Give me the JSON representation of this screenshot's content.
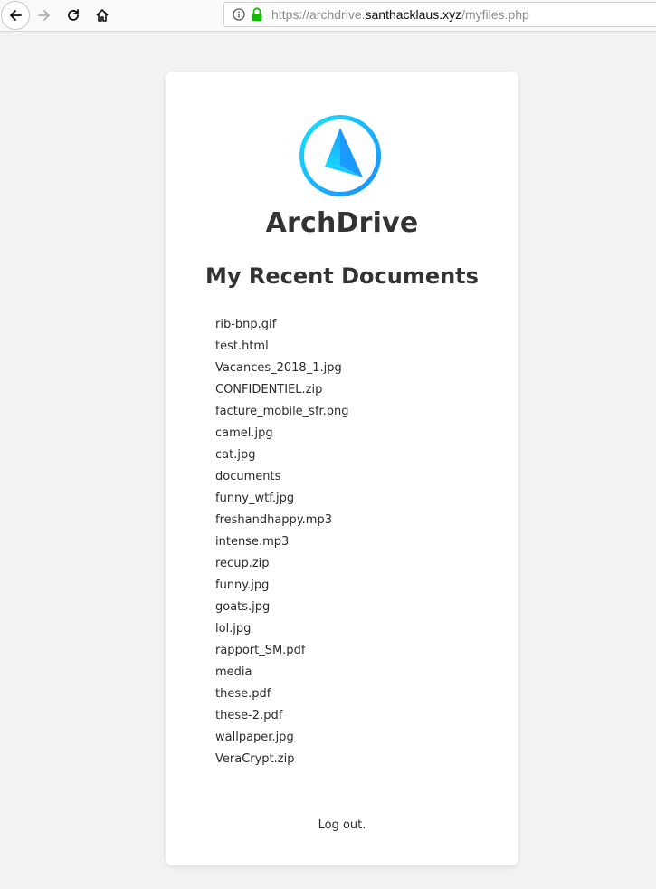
{
  "browser": {
    "url_scheme": "https://archdrive.",
    "url_domain": "santhacklaus.xyz",
    "url_path": "/myfiles.php"
  },
  "colors": {
    "logo_gradient_start": "#19e0ff",
    "logo_gradient_end": "#1a8cff",
    "lock_green": "#12bc00"
  },
  "app": {
    "name": "ArchDrive",
    "heading": "My Recent Documents",
    "files": [
      "rib-bnp.gif",
      "test.html",
      "Vacances_2018_1.jpg",
      "CONFIDENTIEL.zip",
      "facture_mobile_sfr.png",
      "camel.jpg",
      "cat.jpg",
      "documents",
      "funny_wtf.jpg",
      "freshandhappy.mp3",
      "intense.mp3",
      "recup.zip",
      "funny.jpg",
      "goats.jpg",
      "lol.jpg",
      "rapport_SM.pdf",
      "media",
      "these.pdf",
      "these-2.pdf",
      "wallpaper.jpg",
      "VeraCrypt.zip"
    ],
    "logout_label": "Log out."
  }
}
